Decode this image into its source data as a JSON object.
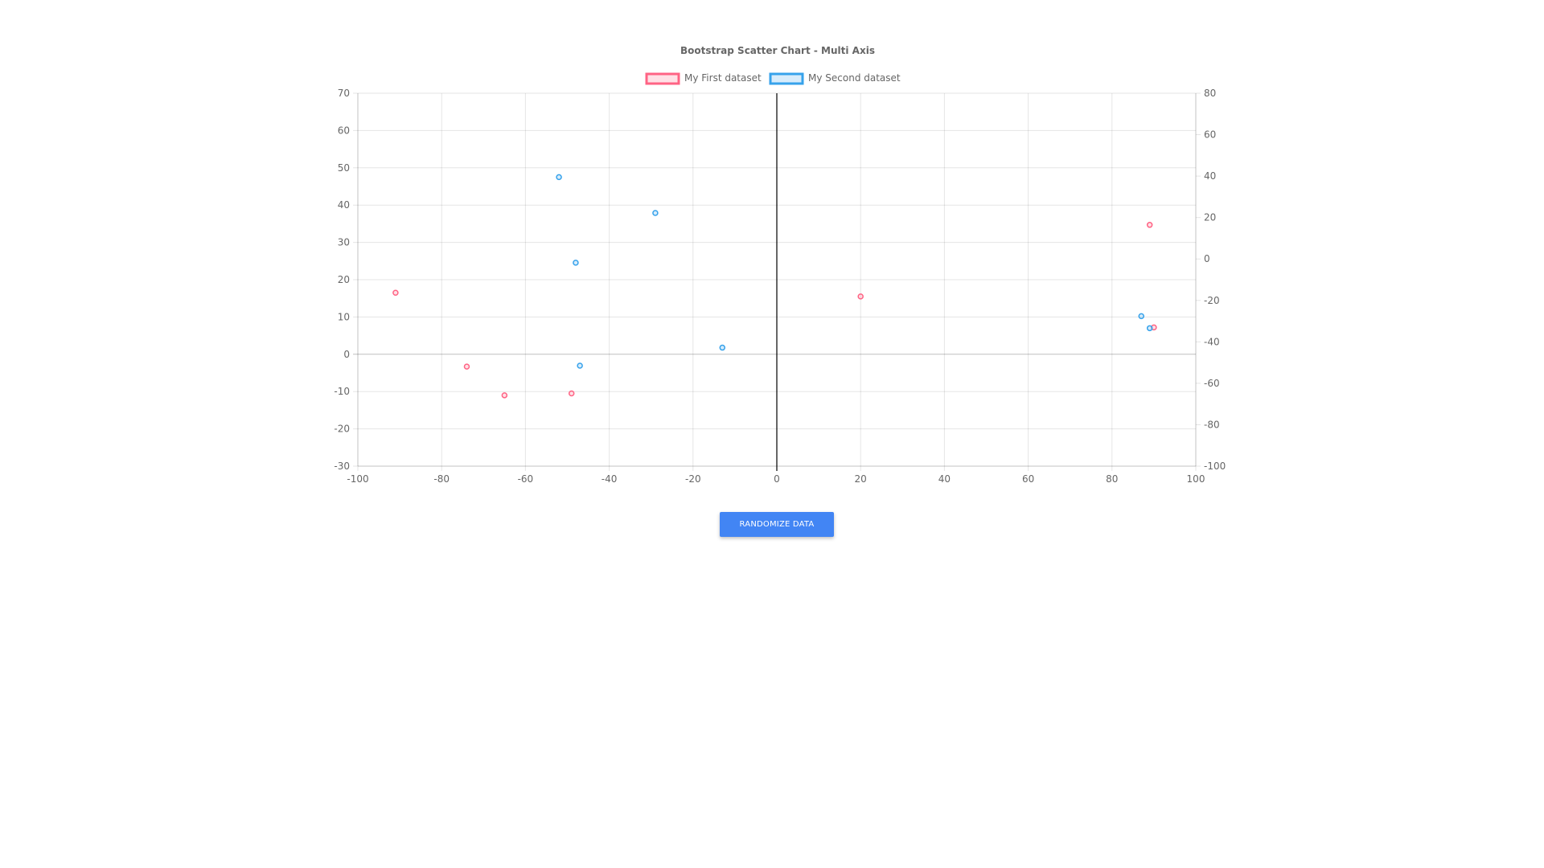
{
  "chart_data": {
    "type": "scatter",
    "title": "Bootstrap Scatter Chart - Multi Axis",
    "legend_position": "top-center",
    "grid": true,
    "x_axis": {
      "min": -100,
      "max": 100,
      "ticks": [
        "-100",
        "-80",
        "-60",
        "-40",
        "-20",
        "0",
        "20",
        "40",
        "60",
        "80",
        "100"
      ]
    },
    "y_axis_left": {
      "min": -30,
      "max": 70,
      "ticks": [
        "70",
        "60",
        "50",
        "40",
        "30",
        "20",
        "10",
        "0",
        "-10",
        "-20",
        "-30"
      ]
    },
    "y_axis_right": {
      "min": -100,
      "max": 80,
      "ticks": [
        "80",
        "60",
        "40",
        "20",
        "0",
        "-20",
        "-40",
        "-60",
        "-80",
        "-100"
      ]
    },
    "series": [
      {
        "name": "My First dataset",
        "axis": "left",
        "color": "#ff6384",
        "fill": "rgba(255,99,132,0.2)",
        "points": [
          {
            "x": -91,
            "y": 16.5
          },
          {
            "x": -74,
            "y": -3.3
          },
          {
            "x": -65,
            "y": -11
          },
          {
            "x": -49,
            "y": -10.5
          },
          {
            "x": 20,
            "y": 15.5
          },
          {
            "x": 89,
            "y": 34.7
          },
          {
            "x": 90,
            "y": 7.2
          }
        ]
      },
      {
        "name": "My Second dataset",
        "axis": "right",
        "color": "#36a2eb",
        "fill": "rgba(54,162,235,0.2)",
        "points": [
          {
            "x": -52,
            "y": 39.5
          },
          {
            "x": -29,
            "y": 22.2
          },
          {
            "x": -48,
            "y": -1.8
          },
          {
            "x": -47,
            "y": -51.5
          },
          {
            "x": -13,
            "y": -42.8
          },
          {
            "x": 87,
            "y": -27.6
          },
          {
            "x": 89,
            "y": -33.4
          }
        ]
      }
    ]
  },
  "controls": {
    "randomize_label": "RANDOMIZE DATA"
  }
}
